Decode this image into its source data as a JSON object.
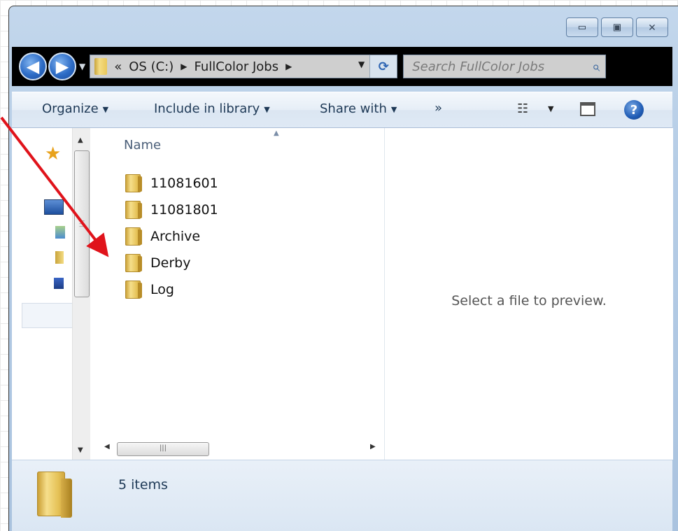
{
  "window": {
    "caption_buttons": [
      {
        "name": "minimize-button",
        "glyph": "▭"
      },
      {
        "name": "maximize-button",
        "glyph": "▣"
      },
      {
        "name": "close-button",
        "glyph": "✕"
      }
    ]
  },
  "nav": {
    "back_icon": "back-arrow-icon",
    "forward_icon": "forward-arrow-icon",
    "back_glyph": "◀",
    "forward_glyph": "▶",
    "overflow": "«",
    "breadcrumb": [
      "OS (C:)",
      "FullColor Jobs"
    ],
    "refresh_glyph": "⟳",
    "search_placeholder": "Search FullColor Jobs",
    "search_glyph": "⌕"
  },
  "toolbar": {
    "organize": "Organize",
    "include_library": "Include in library",
    "share_with": "Share with",
    "more": "»",
    "help_glyph": "?"
  },
  "file_list": {
    "column_name": "Name",
    "items": [
      {
        "name": "11081601"
      },
      {
        "name": "11081801"
      },
      {
        "name": "Archive"
      },
      {
        "name": "Derby"
      },
      {
        "name": "Log"
      }
    ]
  },
  "preview": {
    "message": "Select a file to preview."
  },
  "status": {
    "item_count": "5 items"
  },
  "annotation": {
    "arrow_color": "#e0131b"
  },
  "colors": {
    "accent": "#2d6cc6",
    "window_chrome": "#b6cde6"
  }
}
